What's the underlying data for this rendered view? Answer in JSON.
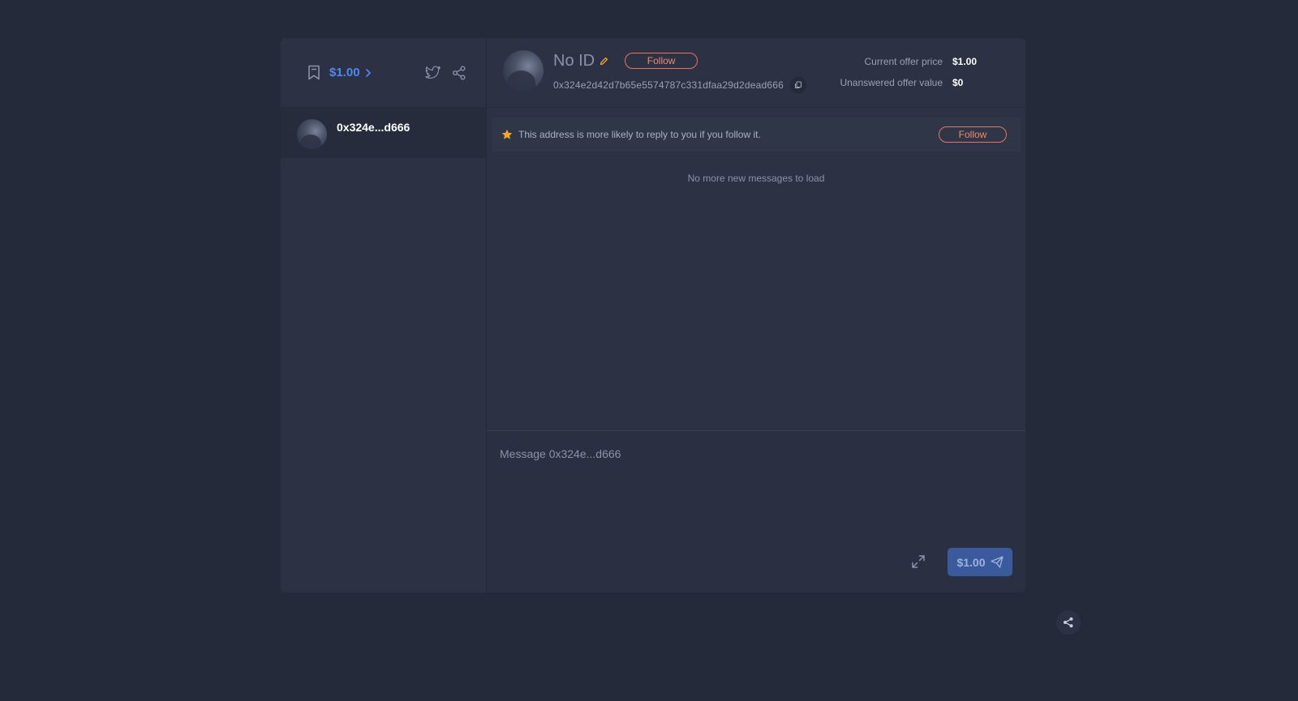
{
  "sidebar": {
    "balance": "$1.00",
    "icons": [
      "bookmark-icon",
      "chevron-right-icon",
      "twitter-icon",
      "share-icon"
    ],
    "conversations": [
      {
        "name": "0x324e...d666"
      }
    ]
  },
  "header": {
    "profile_name": "No ID",
    "follow_label": "Follow",
    "address": "0x324e2d42d7b65e5574787c331dfaa29d2dead666",
    "offer": {
      "current_label": "Current offer price",
      "current_value": "$1.00",
      "unanswered_label": "Unanswered offer value",
      "unanswered_value": "$0"
    }
  },
  "notice": {
    "text": "This address is more likely to reply to you if you follow it.",
    "follow_label": "Follow"
  },
  "messages": {
    "status": "No more new messages to load"
  },
  "composer": {
    "placeholder": "Message 0x324e...d666",
    "send_label": "$1.00"
  },
  "colors": {
    "background": "#242a3a",
    "panel": "#2c3244",
    "accent_blue": "#4e86f5",
    "follow_orange": "#e8735f",
    "send_button": "#3b5a9e",
    "star": "#f5a623"
  }
}
